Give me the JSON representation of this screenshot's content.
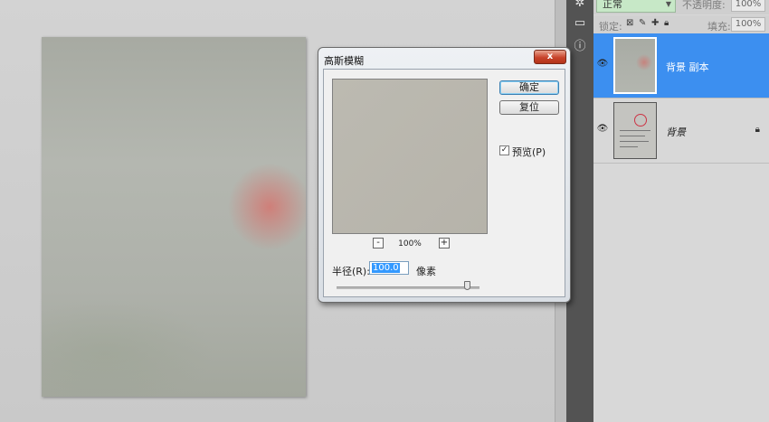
{
  "layers_panel": {
    "blend_mode": "正常",
    "opacity_label": "不透明度:",
    "opacity_value": "100%",
    "lock_label": "锁定:",
    "fill_label": "填充:",
    "fill_value": "100%",
    "layers": [
      {
        "name": "背景 副本",
        "selected": true,
        "visible": true
      },
      {
        "name": "背景",
        "selected": false,
        "visible": true,
        "locked": true
      }
    ]
  },
  "gaussian_blur_dialog": {
    "title": "高斯模糊",
    "close_glyph": "x",
    "ok_label": "确定",
    "reset_label": "复位",
    "preview_checked": true,
    "preview_label": "预览(P)",
    "zoom_out_glyph": "-",
    "zoom_in_glyph": "+",
    "zoom_level": "100%",
    "radius_label": "半径(R):",
    "radius_value": "100.0",
    "unit": "像素"
  },
  "icons": {
    "tool_strip": [
      "gear-icon",
      "image-icon",
      "info-icon"
    ],
    "lock_row": [
      "lock-transparent-icon",
      "lock-brush-icon",
      "lock-move-icon",
      "lock-all-icon"
    ],
    "eye": "eye-icon"
  }
}
